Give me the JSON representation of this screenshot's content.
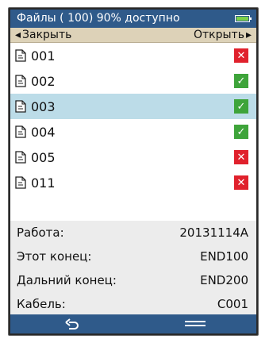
{
  "header": {
    "title": "Файлы ( 100) 90% доступно",
    "battery_icon": "battery-icon"
  },
  "softkeys": {
    "close_label": "Закрыть",
    "open_label": "Открыть",
    "close_arrow": "◂",
    "open_arrow": "▸"
  },
  "files": [
    {
      "name": "001",
      "status": "error"
    },
    {
      "name": "002",
      "status": "ok"
    },
    {
      "name": "003",
      "status": "ok",
      "selected": true
    },
    {
      "name": "004",
      "status": "ok"
    },
    {
      "name": "005",
      "status": "error"
    },
    {
      "name": "011",
      "status": "error"
    }
  ],
  "details": [
    {
      "label": "Работа:",
      "value": "20131114A"
    },
    {
      "label": "Этот конец:",
      "value": "END100"
    },
    {
      "label": "Дальний конец:",
      "value": "END200"
    },
    {
      "label": "Кабель:",
      "value": "C001"
    }
  ],
  "bottom_bar": {
    "back_icon": "back-arrow-icon",
    "menu_icon": "menu-icon"
  },
  "colors": {
    "titlebar": "#2f5a8a",
    "softkeys": "#ddd2b8",
    "selected_row": "#bcdce8",
    "ok": "#3ea43a",
    "error": "#e0212c",
    "info_bg": "#ececec"
  }
}
